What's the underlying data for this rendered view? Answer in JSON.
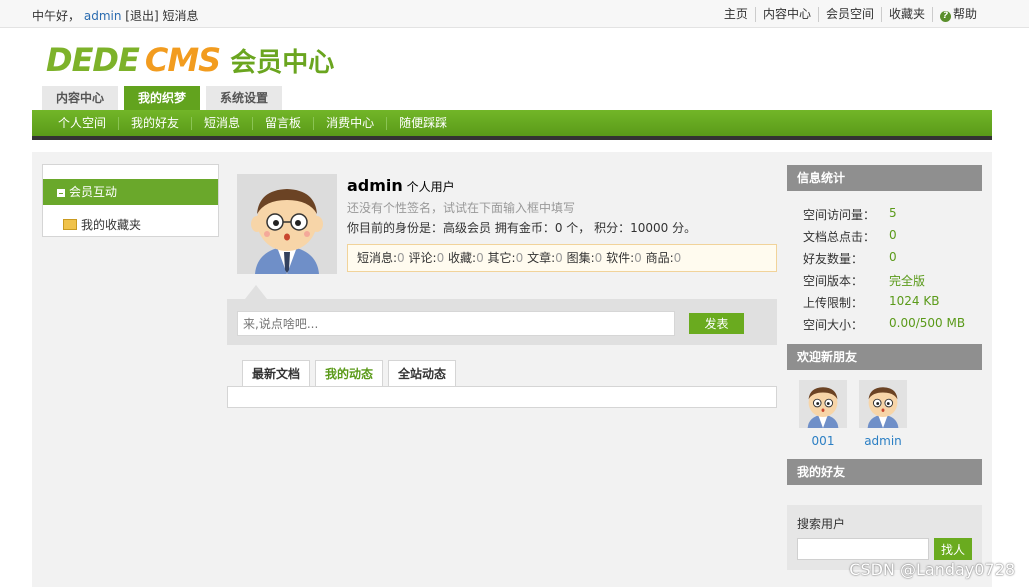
{
  "topbar": {
    "greeting": "中午好，",
    "user": "admin",
    "logout": "[退出]",
    "messages": "短消息",
    "nav": [
      "主页",
      "内容中心",
      "会员空间",
      "收藏夹",
      "帮助"
    ]
  },
  "logo": {
    "part1": "DEDE",
    "part2": "CMS",
    "subtitle": "会员中心"
  },
  "main_tabs": [
    "内容中心",
    "我的织梦",
    "系统设置"
  ],
  "green_nav": [
    "个人空间",
    "我的好友",
    "短消息",
    "留言板",
    "消费中心",
    "随便踩踩"
  ],
  "sidebar": {
    "header": "会员互动",
    "item": "我的收藏夹"
  },
  "profile": {
    "name": "admin",
    "type": "个人用户",
    "signature": "还没有个性签名，试试在下面输入框中填写",
    "identity": "你目前的身份是：高级会员 拥有金币：0 个，  积分：10000 分。",
    "stats": [
      {
        "label": "短消息:",
        "value": "0"
      },
      {
        "label": "评论:",
        "value": "0"
      },
      {
        "label": "收藏:",
        "value": "0"
      },
      {
        "label": "其它:",
        "value": "0"
      },
      {
        "label": "文章:",
        "value": "0"
      },
      {
        "label": "图集:",
        "value": "0"
      },
      {
        "label": "软件:",
        "value": "0"
      },
      {
        "label": "商品:",
        "value": "0"
      }
    ]
  },
  "post": {
    "placeholder": "来,说点啥吧...",
    "button": "发表"
  },
  "activity_tabs": [
    "最新文档",
    "我的动态",
    "全站动态"
  ],
  "info": {
    "header": "信息统计",
    "rows": [
      {
        "label": "空间访问量：",
        "value": "5"
      },
      {
        "label": "文档总点击：",
        "value": "0"
      },
      {
        "label": "好友数量：",
        "value": "0"
      },
      {
        "label": "空间版本：",
        "value": "完全版"
      },
      {
        "label": "上传限制：",
        "value": "1024 KB"
      },
      {
        "label": "空间大小：",
        "value": "0.00/500 MB"
      }
    ]
  },
  "new_friends": {
    "header": "欢迎新朋友",
    "names": [
      "001",
      "admin"
    ]
  },
  "my_friends": {
    "header": "我的好友"
  },
  "search": {
    "label": "搜索用户",
    "button": "找人"
  },
  "watermark": "CSDN @Landay0728",
  "colors": {
    "green": "#62a31e",
    "link": "#2b7fc4",
    "gray_head": "#8f8f8f"
  }
}
